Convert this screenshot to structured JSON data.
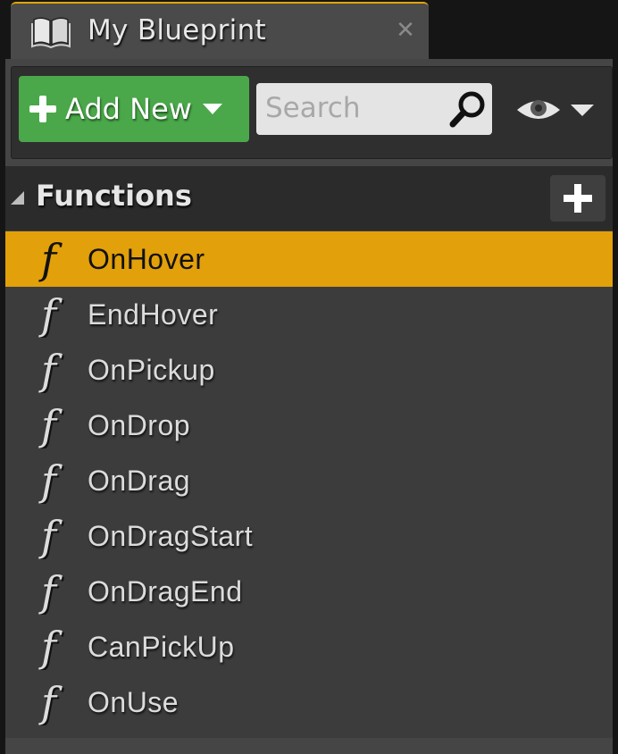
{
  "tab": {
    "title": "My Blueprint",
    "icon": "book-icon",
    "close_icon": "close-icon"
  },
  "toolbar": {
    "add_new_label": "Add New",
    "search_placeholder": "Search",
    "view_options_icon": "eye-icon"
  },
  "functions": {
    "category_label": "Functions",
    "items": [
      {
        "label": "OnHover",
        "selected": true
      },
      {
        "label": "EndHover",
        "selected": false
      },
      {
        "label": "OnPickup",
        "selected": false
      },
      {
        "label": "OnDrop",
        "selected": false
      },
      {
        "label": "OnDrag",
        "selected": false
      },
      {
        "label": "OnDragStart",
        "selected": false
      },
      {
        "label": "OnDragEnd",
        "selected": false
      },
      {
        "label": "CanPickUp",
        "selected": false
      },
      {
        "label": "OnUse",
        "selected": false
      }
    ]
  },
  "colors": {
    "accent": "#e2a00a",
    "add_button": "#4aa84a",
    "panel": "#3c3c3c"
  }
}
